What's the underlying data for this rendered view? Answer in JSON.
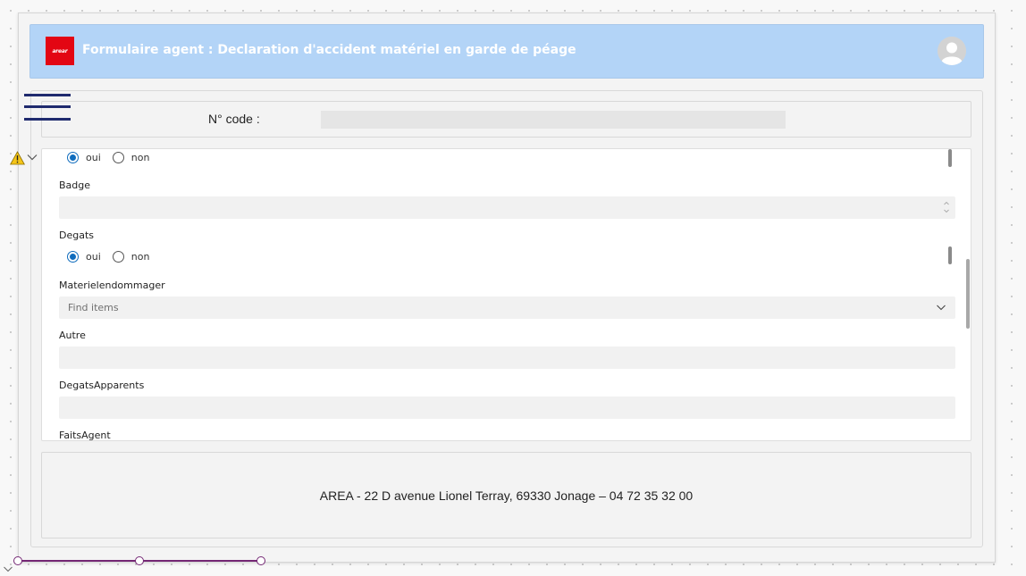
{
  "header": {
    "logo_text": "arear",
    "title": "Formulaire agent : Declaration d'accident matériel en garde de péage"
  },
  "code": {
    "label": "N° code :",
    "value": ""
  },
  "form": {
    "first_radio": {
      "oui": "oui",
      "non": "non",
      "selected": "oui"
    },
    "badge": {
      "label": "Badge",
      "value": ""
    },
    "degats": {
      "label": "Degats",
      "oui": "oui",
      "non": "non",
      "selected": "oui"
    },
    "materiel": {
      "label": "Materielendommager",
      "placeholder": "Find items"
    },
    "autre": {
      "label": "Autre",
      "value": ""
    },
    "degats_apparents": {
      "label": "DegatsApparents",
      "value": ""
    },
    "faits_agent": {
      "label": "FaitsAgent"
    }
  },
  "footer": {
    "address": "AREA - 22 D avenue Lionel Terray, 69330 Jonage – 04 72 35 32 00"
  },
  "icons": {
    "menu": "hamburger-icon",
    "user": "user-avatar-icon",
    "warning": "warning-icon",
    "dropdown": "chevron-down-icon"
  },
  "colors": {
    "header_bg": "#b3d4f7",
    "logo_bg": "#e30613",
    "menu_lines": "#1f2a6e",
    "radio_accent": "#0f6cbd",
    "timeline": "#742774"
  }
}
